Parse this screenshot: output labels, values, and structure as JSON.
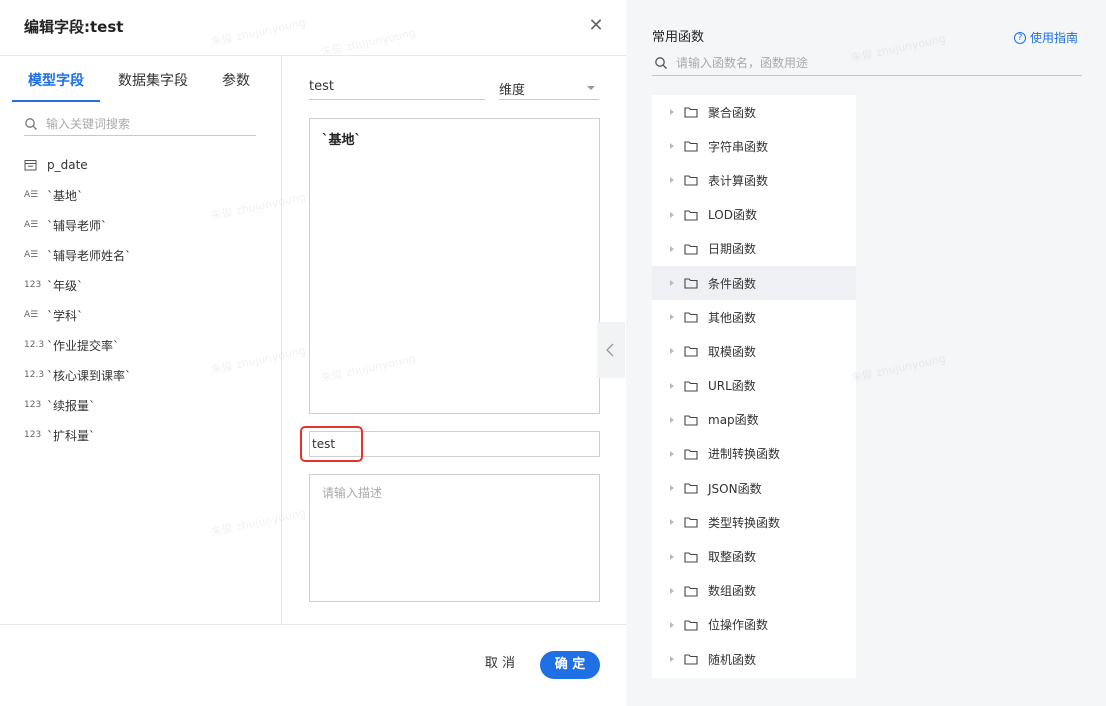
{
  "dialog": {
    "title": "编辑字段:test",
    "close_icon": "close-icon"
  },
  "tabs": [
    {
      "label": "模型字段",
      "active": true
    },
    {
      "label": "数据集字段",
      "active": false
    },
    {
      "label": "参数",
      "active": false
    }
  ],
  "field_search": {
    "placeholder": "输入关键词搜索",
    "value": ""
  },
  "fields": [
    {
      "type_label": "",
      "type_icon": "calendar-icon",
      "name": "p_date"
    },
    {
      "type_label": "A☰",
      "type_icon": "text-field-icon",
      "name": "`基地`"
    },
    {
      "type_label": "A☰",
      "type_icon": "text-field-icon",
      "name": "`辅导老师`"
    },
    {
      "type_label": "A☰",
      "type_icon": "text-field-icon",
      "name": "`辅导老师姓名`"
    },
    {
      "type_label": "123",
      "type_icon": "integer-field-icon",
      "name": "`年级`"
    },
    {
      "type_label": "A☰",
      "type_icon": "text-field-icon",
      "name": "`学科`"
    },
    {
      "type_label": "12.3",
      "type_icon": "decimal-field-icon",
      "name": "`作业提交率`"
    },
    {
      "type_label": "12.3",
      "type_icon": "decimal-field-icon",
      "name": "`核心课到课率`"
    },
    {
      "type_label": "123",
      "type_icon": "integer-field-icon",
      "name": "`续报量`"
    },
    {
      "type_label": "123",
      "type_icon": "integer-field-icon",
      "name": "`扩科量`"
    }
  ],
  "editor": {
    "name_value": "test",
    "type_value": "维度",
    "formula": "`基地`",
    "alias_value": "test",
    "desc_placeholder": "请输入描述"
  },
  "footer": {
    "cancel_label": "取 消",
    "ok_label": "确 定"
  },
  "functions_panel": {
    "title": "常用函数",
    "guide_label": "使用指南",
    "search_placeholder": "请输入函数名，函数用途",
    "categories": [
      "聚合函数",
      "字符串函数",
      "表计算函数",
      "LOD函数",
      "日期函数",
      "条件函数",
      "其他函数",
      "取模函数",
      "URL函数",
      "map函数",
      "进制转换函数",
      "JSON函数",
      "类型转换函数",
      "取整函数",
      "数组函数",
      "位操作函数",
      "随机函数"
    ],
    "hovered_category": "条件函数"
  },
  "colors": {
    "accent": "#1f6fe5",
    "highlight": "#e5342c"
  }
}
